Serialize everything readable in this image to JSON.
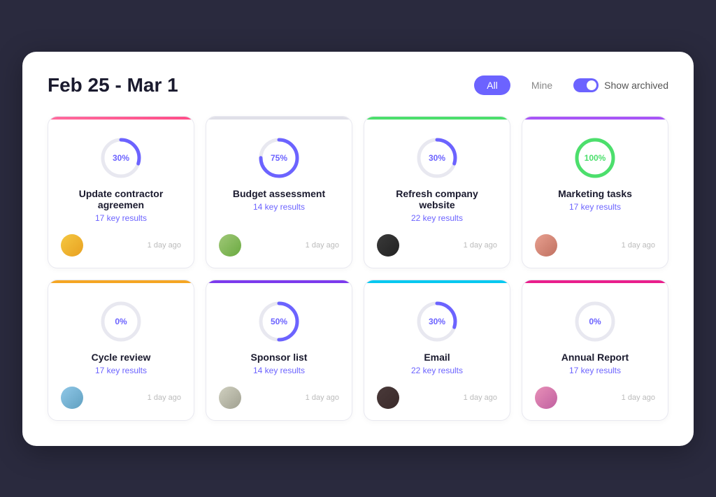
{
  "header": {
    "title": "Feb 25 - Mar 1",
    "filter_all": "All",
    "filter_mine": "Mine",
    "show_archived": "Show archived"
  },
  "cards": [
    {
      "id": "card-1",
      "color_class": "card-pink",
      "progress": 30,
      "progress_color": "purple",
      "title": "Update contractor agreemen",
      "key_results": "17 key results",
      "timestamp": "1 day ago",
      "avatar_class": "av1"
    },
    {
      "id": "card-2",
      "color_class": "card-gray",
      "progress": 75,
      "progress_color": "purple",
      "title": "Budget assessment",
      "key_results": "14 key results",
      "timestamp": "1 day ago",
      "avatar_class": "av2"
    },
    {
      "id": "card-3",
      "color_class": "card-green",
      "progress": 30,
      "progress_color": "purple",
      "title": "Refresh company website",
      "key_results": "22 key results",
      "timestamp": "1 day ago",
      "avatar_class": "av3"
    },
    {
      "id": "card-4",
      "color_class": "card-purple",
      "progress": 100,
      "progress_color": "green",
      "title": "Marketing tasks",
      "key_results": "17 key results",
      "timestamp": "1 day ago",
      "avatar_class": "av4"
    },
    {
      "id": "card-5",
      "color_class": "card-yellow",
      "progress": 0,
      "progress_color": "purple",
      "title": "Cycle review",
      "key_results": "17 key results",
      "timestamp": "1 day ago",
      "avatar_class": "av5"
    },
    {
      "id": "card-6",
      "color_class": "card-deep-purple",
      "progress": 50,
      "progress_color": "purple",
      "title": "Sponsor list",
      "key_results": "14 key results",
      "timestamp": "1 day ago",
      "avatar_class": "av6"
    },
    {
      "id": "card-7",
      "color_class": "card-cyan",
      "progress": 30,
      "progress_color": "purple",
      "title": "Email",
      "key_results": "22 key results",
      "timestamp": "1 day ago",
      "avatar_class": "av7"
    },
    {
      "id": "card-8",
      "color_class": "card-magenta",
      "progress": 0,
      "progress_color": "purple",
      "title": "Annual Report",
      "key_results": "17 key results",
      "timestamp": "1 day ago",
      "avatar_class": "av8"
    }
  ]
}
